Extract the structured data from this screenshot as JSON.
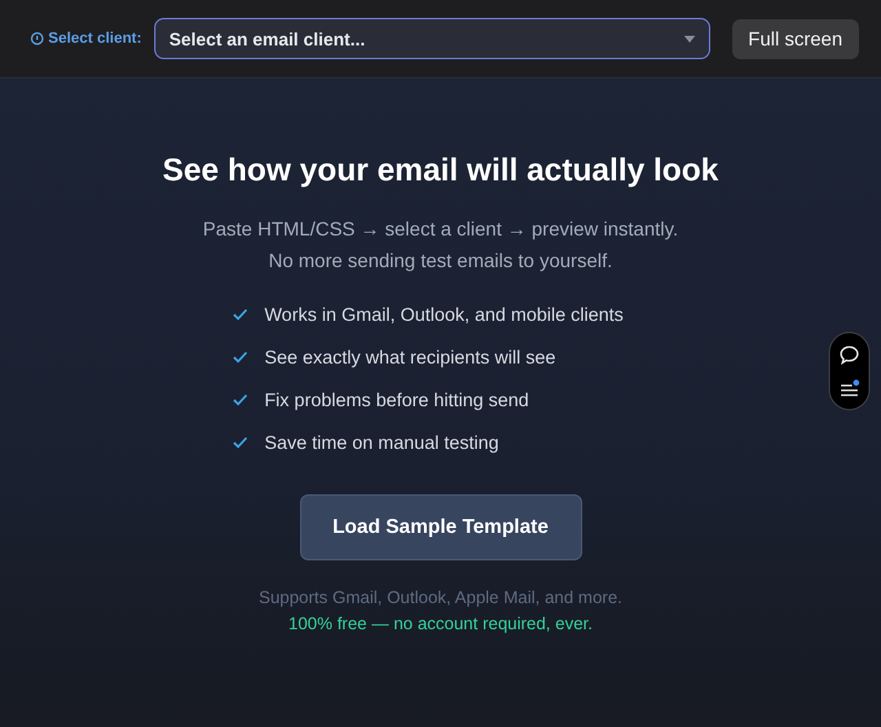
{
  "toolbar": {
    "label": "Select client:",
    "select": {
      "placeholder": "Select an email client..."
    },
    "fullscreen_button": "Full screen"
  },
  "hero": {
    "title": "See how your email will actually look",
    "subtitle_lines": [
      "Paste HTML/CSS → select a client → preview instantly.",
      "No more sending test emails to yourself."
    ],
    "features": [
      "Works in Gmail, Outlook, and mobile clients",
      "See exactly what recipients will see",
      "Fix problems before hitting send",
      "Save time on manual testing"
    ],
    "button": "Load Sample Template",
    "note": "Supports Gmail, Outlook, Apple Mail, and more.",
    "free_note": "100% free — no account required, ever."
  }
}
